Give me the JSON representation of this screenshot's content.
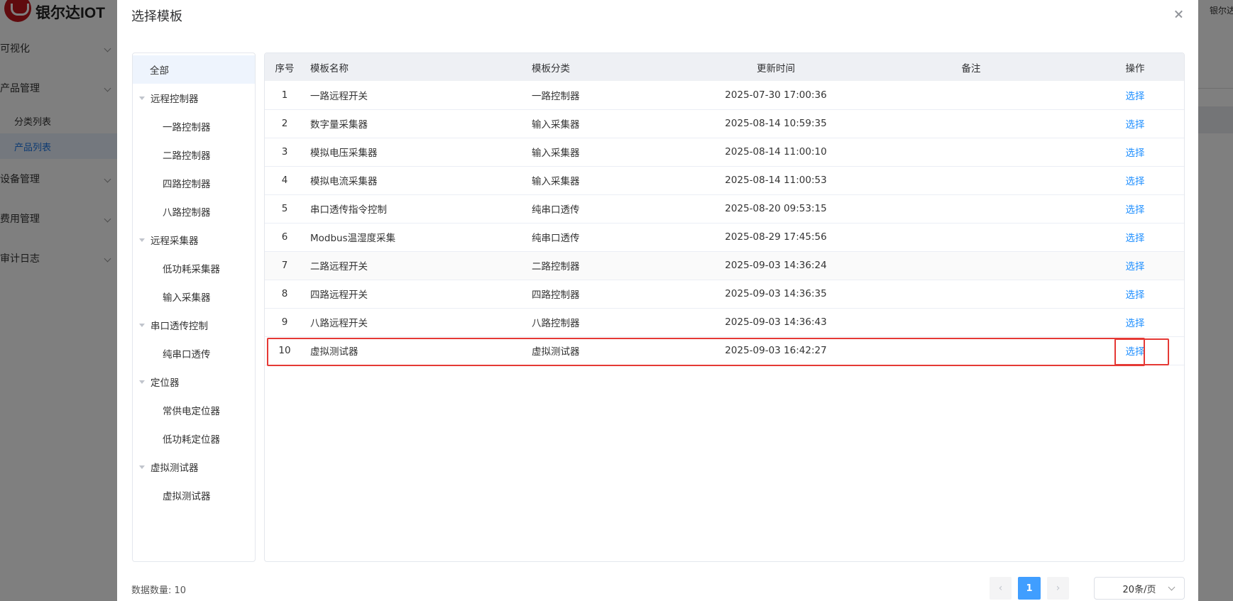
{
  "background": {
    "logo_text": "银尔达IOT",
    "menu": [
      {
        "label": "可视化"
      },
      {
        "label": "产品管理"
      }
    ],
    "submenu": [
      {
        "label": "分类列表"
      },
      {
        "label": "产品列表"
      }
    ],
    "menu2": [
      {
        "label": "设备管理"
      },
      {
        "label": "费用管理"
      },
      {
        "label": "审计日志"
      }
    ],
    "right_text": "银尔达"
  },
  "dialog": {
    "title": "选择模板",
    "tree": {
      "all": "全部",
      "groups": [
        {
          "label": "远程控制器",
          "children": [
            "一路控制器",
            "二路控制器",
            "四路控制器",
            "八路控制器"
          ]
        },
        {
          "label": "远程采集器",
          "children": [
            "低功耗采集器",
            "输入采集器"
          ]
        },
        {
          "label": "串口透传控制",
          "children": [
            "纯串口透传"
          ]
        },
        {
          "label": "定位器",
          "children": [
            "常供电定位器",
            "低功耗定位器"
          ]
        },
        {
          "label": "虚拟测试器",
          "children": [
            "虚拟测试器"
          ]
        }
      ]
    },
    "table": {
      "headers": {
        "index": "序号",
        "name": "模板名称",
        "category": "模板分类",
        "updated": "更新时间",
        "remark": "备注",
        "action": "操作"
      },
      "rows": [
        {
          "index": "1",
          "name": "一路远程开关",
          "category": "一路控制器",
          "updated": "2025-07-30 17:00:36",
          "remark": "",
          "action": "选择"
        },
        {
          "index": "2",
          "name": "数字量采集器",
          "category": "输入采集器",
          "updated": "2025-08-14 10:59:35",
          "remark": "",
          "action": "选择"
        },
        {
          "index": "3",
          "name": "模拟电压采集器",
          "category": "输入采集器",
          "updated": "2025-08-14 11:00:10",
          "remark": "",
          "action": "选择"
        },
        {
          "index": "4",
          "name": "模拟电流采集器",
          "category": "输入采集器",
          "updated": "2025-08-14 11:00:53",
          "remark": "",
          "action": "选择"
        },
        {
          "index": "5",
          "name": "串口透传指令控制",
          "category": "纯串口透传",
          "updated": "2025-08-20 09:53:15",
          "remark": "",
          "action": "选择"
        },
        {
          "index": "6",
          "name": "Modbus温湿度采集",
          "category": "纯串口透传",
          "updated": "2025-08-29 17:45:56",
          "remark": "",
          "action": "选择"
        },
        {
          "index": "7",
          "name": "二路远程开关",
          "category": "二路控制器",
          "updated": "2025-09-03 14:36:24",
          "remark": "",
          "action": "选择"
        },
        {
          "index": "8",
          "name": "四路远程开关",
          "category": "四路控制器",
          "updated": "2025-09-03 14:36:35",
          "remark": "",
          "action": "选择"
        },
        {
          "index": "9",
          "name": "八路远程开关",
          "category": "八路控制器",
          "updated": "2025-09-03 14:36:43",
          "remark": "",
          "action": "选择"
        },
        {
          "index": "10",
          "name": "虚拟测试器",
          "category": "虚拟测试器",
          "updated": "2025-09-03 16:42:27",
          "remark": "",
          "action": "选择"
        }
      ]
    },
    "footer": {
      "count_label": "数据数量: 10",
      "prev": "‹",
      "page": "1",
      "next": "›",
      "page_size": "20条/页"
    },
    "highlight_color": "#e53935",
    "link_color": "#1f8fff",
    "accent_color": "#409eff"
  }
}
